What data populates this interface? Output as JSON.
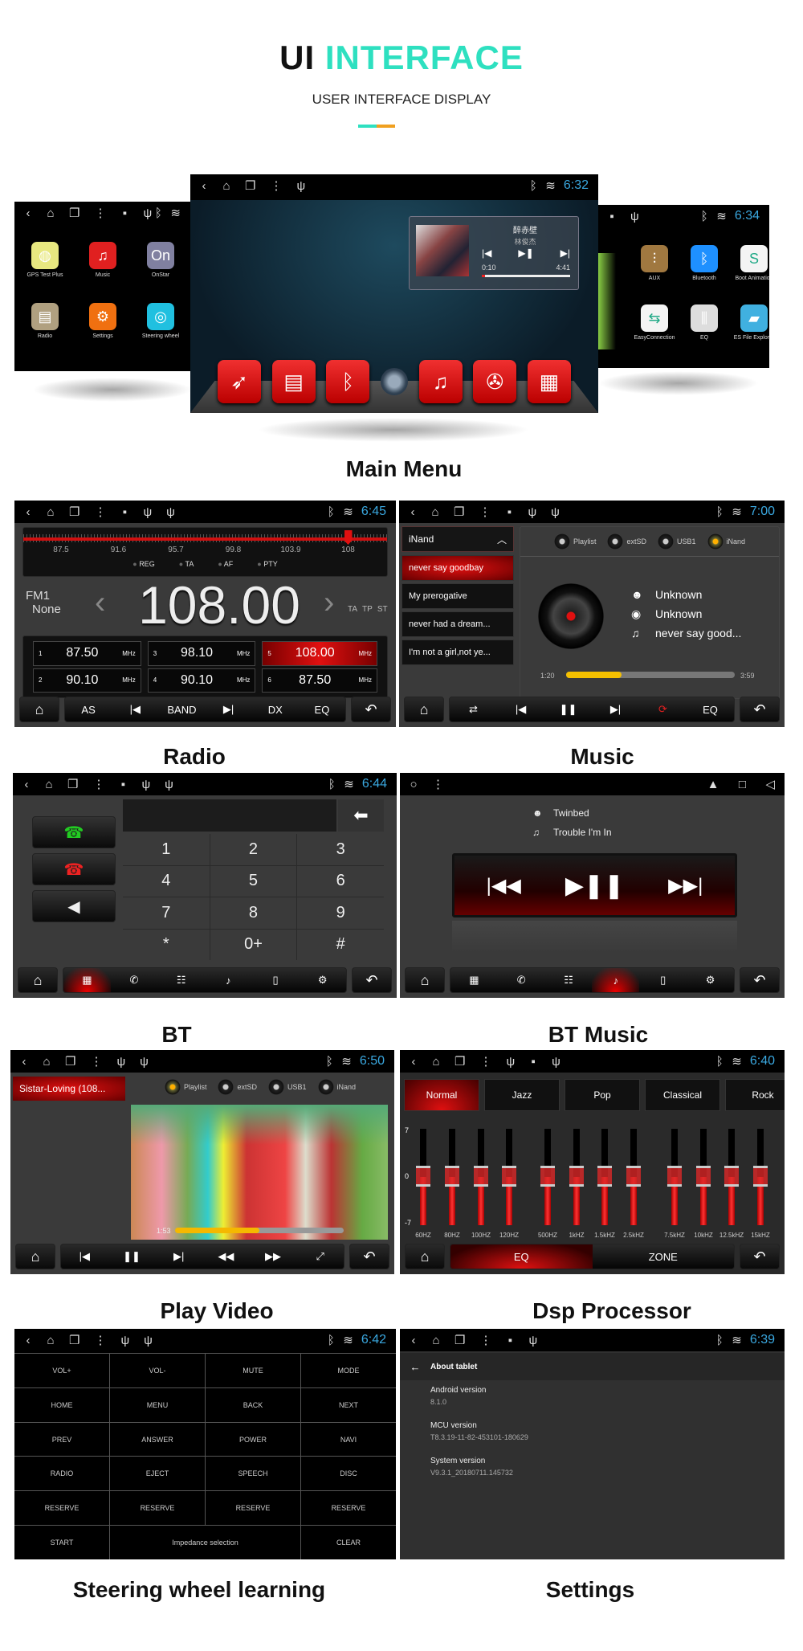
{
  "header": {
    "title_a": "UI",
    "title_b": "INTERFACE",
    "subtitle": "USER INTERFACE DISPLAY",
    "accent": "#2ee0c0"
  },
  "colors": {
    "time": "#3aa8e0",
    "active_red": "#d01010",
    "panel_gray": "#3a3a3a",
    "progress_yellow": "#f5c000"
  },
  "sections": {
    "main_menu": "Main Menu",
    "radio": "Radio",
    "music": "Music",
    "bt": "BT",
    "bt_music": "BT Music",
    "play_video": "Play Video",
    "dsp": "Dsp Processor",
    "steering": "Steering wheel learning",
    "settings": "Settings"
  },
  "main_menu": {
    "left": {
      "status_icons": [
        "back",
        "home",
        "recents",
        "menu",
        "image",
        "usb"
      ],
      "apps": [
        {
          "label": "GPS Test Plus",
          "icon": "globe",
          "color": "#e8e880"
        },
        {
          "label": "Music",
          "icon": "music-note",
          "color": "#e02020"
        },
        {
          "label": "OnStar",
          "icon": "onstar",
          "color": "#8080a0"
        },
        {
          "label": "Radio",
          "icon": "radio",
          "color": "#b0a080"
        },
        {
          "label": "Settings",
          "icon": "gear",
          "color": "#f07010"
        },
        {
          "label": "Steering wheel",
          "icon": "steering-wheel",
          "color": "#20c0e0"
        }
      ]
    },
    "center": {
      "status_icons": [
        "back",
        "home",
        "recents",
        "menu",
        "usb"
      ],
      "time": "6:32",
      "widget": {
        "title": "醉赤壁",
        "artist": "林俊杰",
        "elapsed": "0:10",
        "total": "4:41",
        "progress": 0.04
      },
      "dock": [
        "navigation",
        "radio",
        "bluetooth",
        "circle",
        "music-note",
        "video",
        "apps"
      ]
    },
    "right": {
      "status_icons": [
        "image",
        "usb"
      ],
      "time": "6:34",
      "apps": [
        {
          "label": "AUX",
          "icon": "aux",
          "color": "#a07840"
        },
        {
          "label": "Bluetooth",
          "icon": "bluetooth",
          "color": "#1e90ff"
        },
        {
          "label": "Boot Animation",
          "icon": "boot-animation",
          "color": "#f4f4f4"
        },
        {
          "label": "EasyConnection",
          "icon": "easyconnection",
          "color": "#f4f4f4"
        },
        {
          "label": "EQ",
          "icon": "eq",
          "color": "#ddd"
        },
        {
          "label": "ES File Explorer",
          "icon": "folder",
          "color": "#40b0e0"
        }
      ]
    }
  },
  "radio": {
    "status_icons": [
      "back",
      "home",
      "recents",
      "menu",
      "image",
      "usb",
      "usb"
    ],
    "time": "6:45",
    "scale": [
      "87.5",
      "91.6",
      "95.7",
      "99.8",
      "103.9",
      "108"
    ],
    "scale_min": 87.5,
    "scale_max": 108,
    "tuned": 108,
    "indicators": [
      "REG",
      "TA",
      "AF",
      "PTY"
    ],
    "band": "FM1",
    "station": "None",
    "frequency": "108.00",
    "flags": [
      "TA",
      "TP",
      "ST"
    ],
    "presets": [
      {
        "num": "1",
        "freq": "87.50",
        "unit": "MHz",
        "active": false
      },
      {
        "num": "2",
        "freq": "90.10",
        "unit": "MHz",
        "active": false
      },
      {
        "num": "3",
        "freq": "98.10",
        "unit": "MHz",
        "active": false
      },
      {
        "num": "4",
        "freq": "90.10",
        "unit": "MHz",
        "active": false
      },
      {
        "num": "5",
        "freq": "108.00",
        "unit": "MHz",
        "active": true
      },
      {
        "num": "6",
        "freq": "87.50",
        "unit": "MHz",
        "active": false
      }
    ],
    "bottom": [
      {
        "label": "AS"
      },
      {
        "icon": "prev-track"
      },
      {
        "label": "BAND"
      },
      {
        "icon": "next-track"
      },
      {
        "label": "DX"
      },
      {
        "label": "EQ"
      }
    ]
  },
  "music": {
    "status_icons": [
      "back",
      "home",
      "recents",
      "menu",
      "image",
      "usb",
      "usb"
    ],
    "time": "7:00",
    "source_header": "iNand",
    "songs": [
      {
        "title": "never say goodbay",
        "active": true
      },
      {
        "title": "My prerogative",
        "active": false
      },
      {
        "title": "never had a dream...",
        "active": false
      },
      {
        "title": "I'm not a girl,not ye...",
        "active": false
      }
    ],
    "sources": [
      {
        "label": "Playlist",
        "active": false
      },
      {
        "label": "extSD",
        "active": false
      },
      {
        "label": "USB1",
        "active": false
      },
      {
        "label": "iNand",
        "active": true
      }
    ],
    "artist": "Unknown",
    "album": "Unknown",
    "track": "never say good...",
    "elapsed": "1:20",
    "total": "3:59",
    "progress": 0.33,
    "bottom": [
      {
        "icon": "shuffle"
      },
      {
        "icon": "prev-track"
      },
      {
        "icon": "pause"
      },
      {
        "icon": "next-track"
      },
      {
        "icon": "repeat",
        "red": true
      },
      {
        "label": "EQ"
      }
    ]
  },
  "bt": {
    "status_icons": [
      "back",
      "home",
      "recents",
      "menu",
      "image",
      "usb",
      "usb"
    ],
    "time": "6:44",
    "keys": [
      "1",
      "2",
      "3",
      "4",
      "5",
      "6",
      "7",
      "8",
      "9",
      "*",
      "0+",
      "#"
    ],
    "bottom": [
      {
        "icon": "dialpad",
        "active": true
      },
      {
        "icon": "call-log"
      },
      {
        "icon": "contacts"
      },
      {
        "icon": "bt-music"
      },
      {
        "icon": "phone-link"
      },
      {
        "icon": "settings"
      }
    ]
  },
  "bt_music": {
    "status_icons": [
      "circle",
      "menu"
    ],
    "right_icons": [
      "eject",
      "square",
      "back-triangle"
    ],
    "artist": "Twinbed",
    "track": "Trouble I'm In",
    "bottom": [
      {
        "icon": "dialpad"
      },
      {
        "icon": "call-log"
      },
      {
        "icon": "contacts"
      },
      {
        "icon": "bt-music",
        "active": true
      },
      {
        "icon": "phone-link"
      },
      {
        "icon": "settings"
      }
    ]
  },
  "video": {
    "status_icons": [
      "back",
      "home",
      "recents",
      "menu",
      "usb",
      "usb"
    ],
    "time": "6:50",
    "title": "Sistar-Loving (108...",
    "sources": [
      {
        "label": "Playlist",
        "active": true
      },
      {
        "label": "extSD",
        "active": false
      },
      {
        "label": "USB1",
        "active": false
      },
      {
        "label": "iNand",
        "active": false
      }
    ],
    "elapsed": "1:53",
    "progress": 0.5,
    "bottom": [
      {
        "icon": "prev-track"
      },
      {
        "icon": "pause"
      },
      {
        "icon": "next-track"
      },
      {
        "icon": "rewind"
      },
      {
        "icon": "fast-forward"
      },
      {
        "icon": "fullscreen"
      }
    ]
  },
  "dsp": {
    "status_icons": [
      "back",
      "home",
      "recents",
      "menu",
      "usb",
      "image",
      "usb"
    ],
    "time": "6:40",
    "presets": [
      {
        "label": "Normal",
        "active": true
      },
      {
        "label": "Jazz",
        "active": false
      },
      {
        "label": "Pop",
        "active": false
      },
      {
        "label": "Classical",
        "active": false
      },
      {
        "label": "Rock",
        "active": false
      }
    ],
    "scale_labels": [
      "7",
      "0",
      "-7"
    ],
    "range": [
      -7,
      7
    ],
    "bands": [
      {
        "label": "60HZ",
        "value": 0
      },
      {
        "label": "80HZ",
        "value": 0
      },
      {
        "label": "100HZ",
        "value": 0
      },
      {
        "label": "120HZ",
        "value": 0
      },
      {
        "label": "500HZ",
        "value": 0
      },
      {
        "label": "1kHZ",
        "value": 0
      },
      {
        "label": "1.5kHZ",
        "value": 0
      },
      {
        "label": "2.5kHZ",
        "value": 0
      },
      {
        "label": "7.5kHZ",
        "value": 0
      },
      {
        "label": "10kHZ",
        "value": 0
      },
      {
        "label": "12.5kHZ",
        "value": 0
      },
      {
        "label": "15kHZ",
        "value": 0
      }
    ],
    "tabs": [
      {
        "label": "EQ",
        "active": true
      },
      {
        "label": "ZONE",
        "active": false
      }
    ]
  },
  "steering": {
    "status_icons": [
      "back",
      "home",
      "recents",
      "menu",
      "usb",
      "usb"
    ],
    "time": "6:42",
    "buttons": [
      "VOL+",
      "VOL-",
      "MUTE",
      "MODE",
      "HOME",
      "MENU",
      "BACK",
      "NEXT",
      "PREV",
      "ANSWER",
      "POWER",
      "NAVI",
      "RADIO",
      "EJECT",
      "SPEECH",
      "DISC",
      "RESERVE",
      "RESERVE",
      "RESERVE",
      "RESERVE"
    ],
    "last_row": [
      "START",
      "Impedance selection",
      "CLEAR"
    ]
  },
  "settings": {
    "status_icons": [
      "back",
      "home",
      "recents",
      "menu",
      "image",
      "usb"
    ],
    "time": "6:39",
    "title": "About tablet",
    "items": [
      {
        "label": "Android version",
        "value": "8.1.0"
      },
      {
        "label": "MCU version",
        "value": "T8.3.19-11-82-453101-180629"
      },
      {
        "label": "System version",
        "value": "V9.3.1_20180711.145732"
      }
    ]
  }
}
